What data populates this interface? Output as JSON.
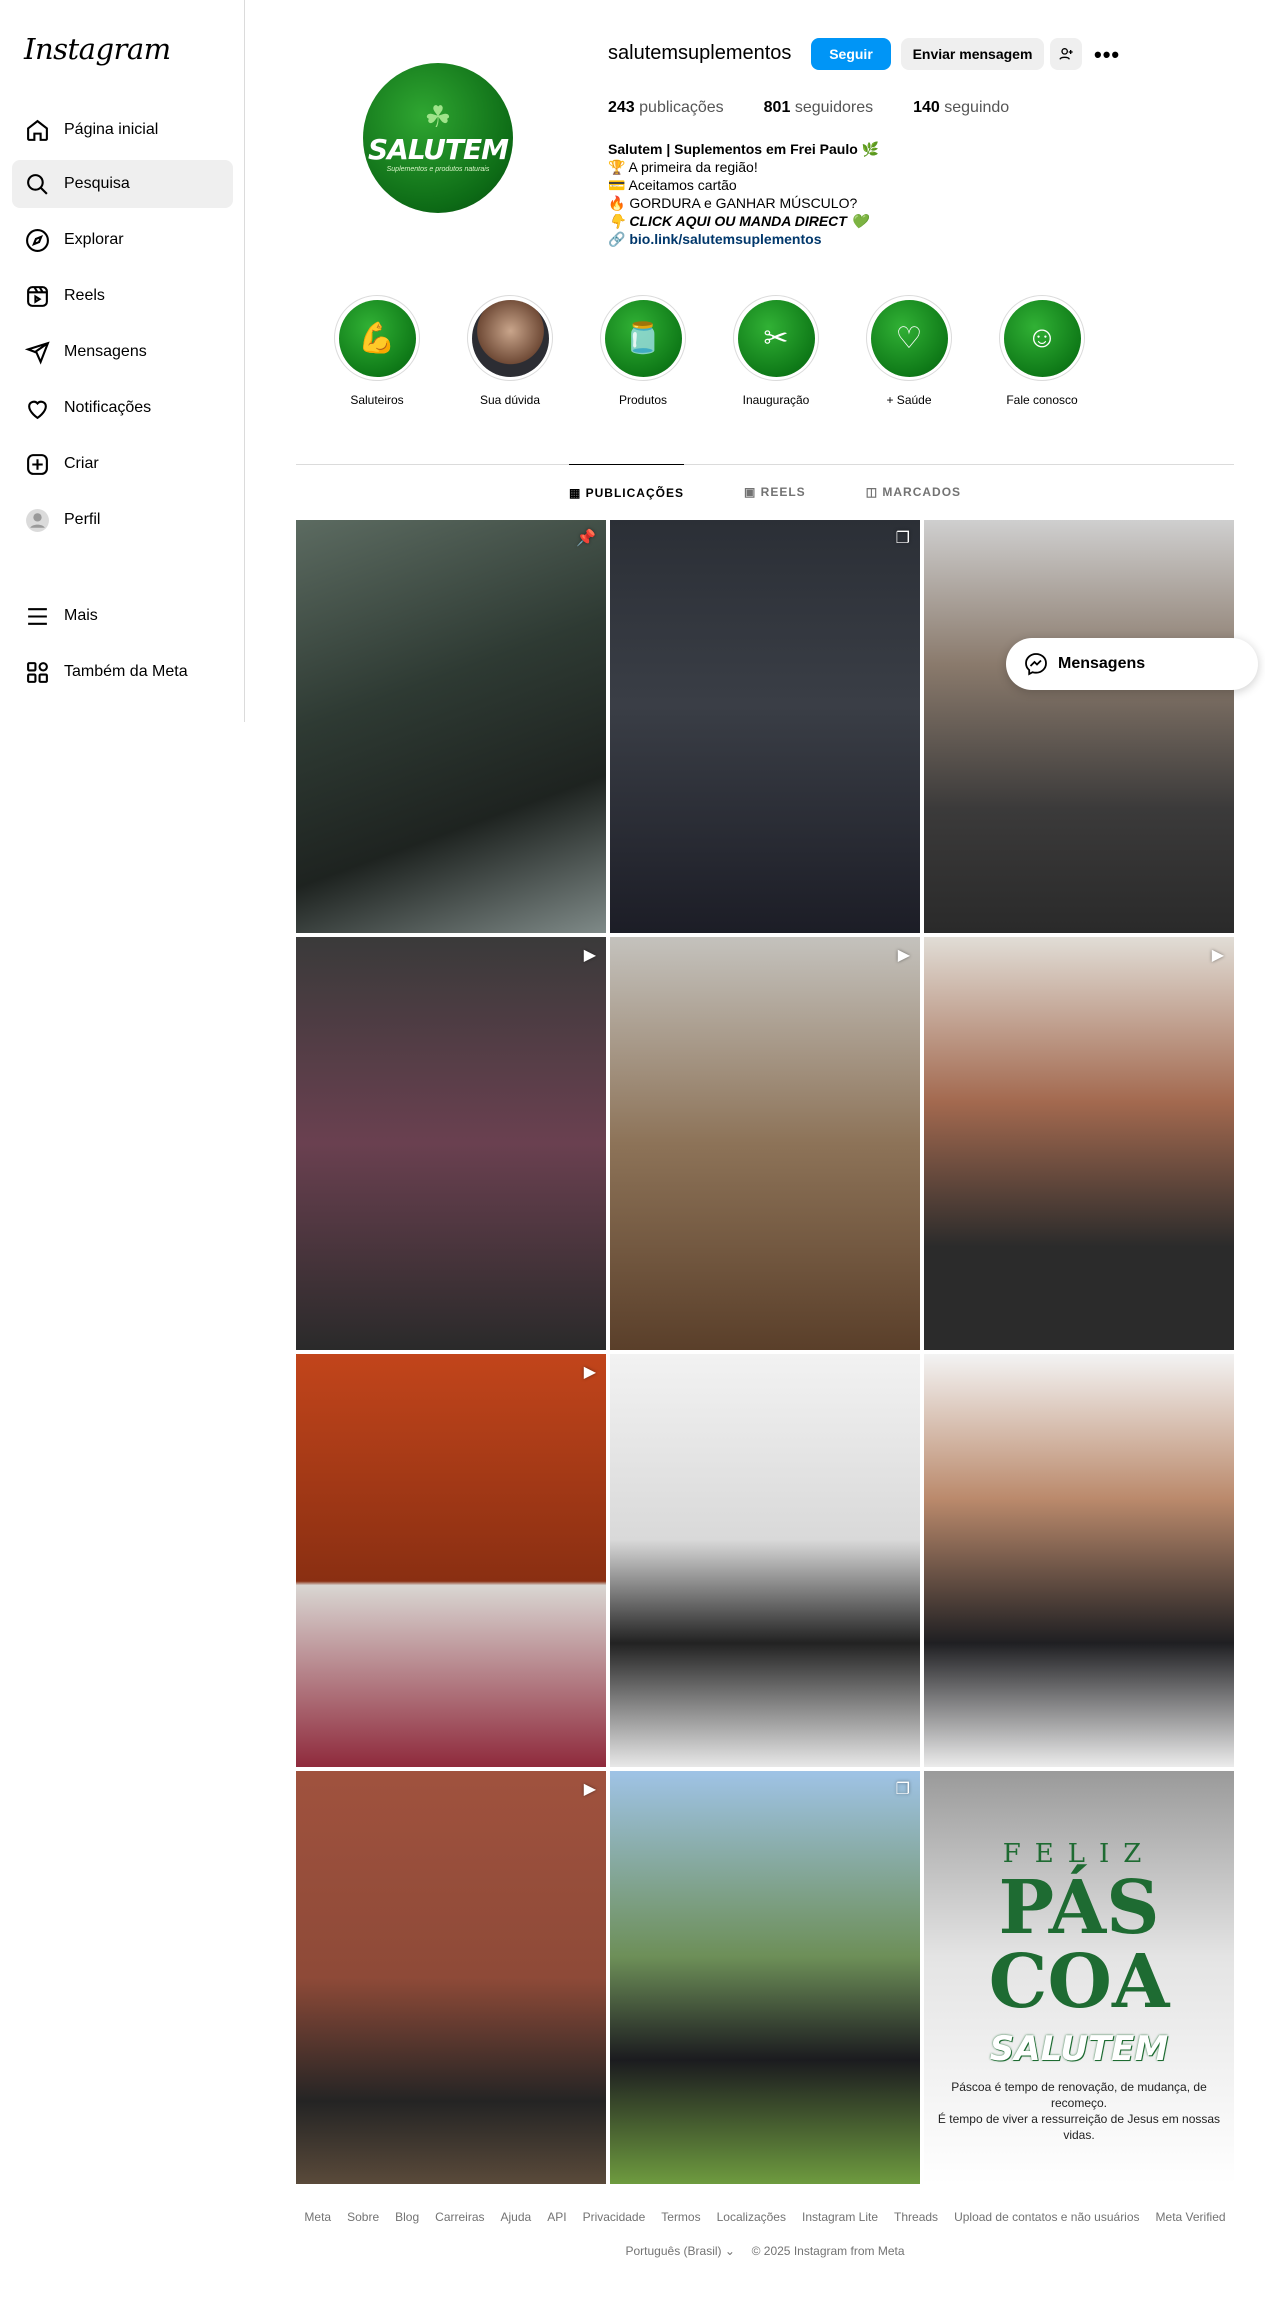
{
  "brand": "Instagram",
  "nav": [
    {
      "label": "Página inicial",
      "icon": "home-icon"
    },
    {
      "label": "Pesquisa",
      "icon": "search-icon"
    },
    {
      "label": "Explorar",
      "icon": "compass-icon"
    },
    {
      "label": "Reels",
      "icon": "reels-icon"
    },
    {
      "label": "Mensagens",
      "icon": "send-icon"
    },
    {
      "label": "Notificações",
      "icon": "heart-icon"
    },
    {
      "label": "Criar",
      "icon": "plus-square-icon"
    },
    {
      "label": "Perfil",
      "icon": "profile-avatar-icon"
    },
    {
      "label": "Mais",
      "icon": "menu-icon"
    },
    {
      "label": "Também da Meta",
      "icon": "meta-apps-icon"
    }
  ],
  "active_nav": "Pesquisa",
  "profile": {
    "avatar_brand": "SALUTEM",
    "avatar_tagline": "Suplementos e produtos naturais",
    "username": "salutemsuplementos",
    "follow_label": "Seguir",
    "message_label": "Enviar mensagem",
    "stats": {
      "posts_count": "243",
      "posts_label": "publicações",
      "followers_count": "801",
      "followers_label": "seguidores",
      "following_count": "140",
      "following_label": "seguindo"
    },
    "bio": {
      "name": "Salutem | Suplementos em Frei Paulo 🌿",
      "line1": "🏆 A primeira da região!",
      "line2": "💳 Aceitamos cartão",
      "line3": "🔥 GORDURA e GANHAR MÚSCULO?",
      "line4": "👇 CLICK AQUI OU MANDA DIRECT 💚",
      "link": "bio.link/salutemsuplementos"
    }
  },
  "highlights": [
    {
      "label": "Saluteiros",
      "icon": "muscle-icon"
    },
    {
      "label": "Sua dúvida",
      "icon": "person-photo"
    },
    {
      "label": "Produtos",
      "icon": "supplement-jar-icon"
    },
    {
      "label": "Inauguração",
      "icon": "scissors-ribbon-icon"
    },
    {
      "label": "+ Saúde",
      "icon": "heart-plus-icon"
    },
    {
      "label": "Fale conosco",
      "icon": "support-agent-icon"
    }
  ],
  "tabs": [
    {
      "label": "PUBLICAÇÕES",
      "icon": "grid-icon"
    },
    {
      "label": "REELS",
      "icon": "reels-icon"
    },
    {
      "label": "MARCADOS",
      "icon": "tagged-icon"
    }
  ],
  "active_tab": "PUBLICAÇÕES",
  "posts": [
    {
      "badge": "pinned-icon"
    },
    {
      "badge": "carousel-icon"
    },
    {
      "badge": ""
    },
    {
      "badge": "reel-icon"
    },
    {
      "badge": "reel-icon"
    },
    {
      "badge": "reel-icon"
    },
    {
      "badge": "reel-icon"
    },
    {
      "badge": ""
    },
    {
      "badge": ""
    },
    {
      "badge": "reel-icon"
    },
    {
      "badge": "carousel-icon"
    },
    {
      "badge": ""
    }
  ],
  "easter_post": {
    "feliz": "FELIZ",
    "pascoa_1": "PÁS",
    "pascoa_2": "COA",
    "brand": "SALUTEM",
    "message_1": "Páscoa é tempo de renovação, de mudança, de recomeço.",
    "message_2": "É tempo de viver a ressurreição de Jesus em nossas vidas."
  },
  "floating_messages_label": "Mensagens",
  "footer": {
    "links": [
      "Meta",
      "Sobre",
      "Blog",
      "Carreiras",
      "Ajuda",
      "API",
      "Privacidade",
      "Termos",
      "Localizações",
      "Instagram Lite",
      "Threads",
      "Upload de contatos e não usuários",
      "Meta Verified"
    ],
    "language": "Português (Brasil)",
    "copyright": "© 2025 Instagram from Meta"
  },
  "colors": {
    "accent": "#0095f6",
    "brand_green": "#0f7a18"
  }
}
